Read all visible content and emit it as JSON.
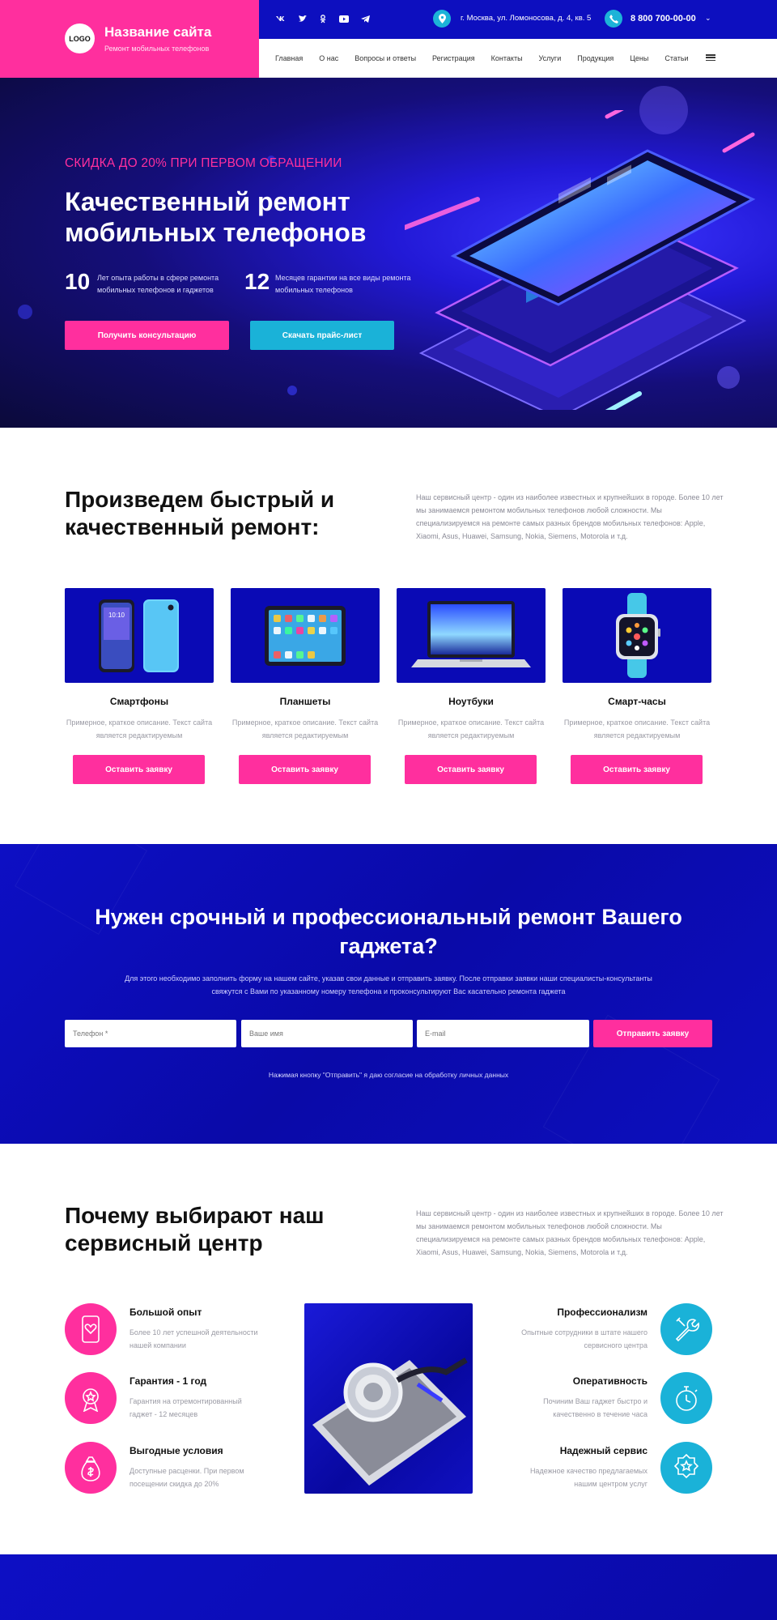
{
  "header": {
    "logo": "LOGO",
    "site_title": "Название сайта",
    "site_subtitle": "Ремонт мобильных телефонов",
    "socials": [
      "vk-icon",
      "twitter-icon",
      "odnoklassniki-icon",
      "youtube-icon",
      "telegram-icon"
    ],
    "address": "г. Москва, ул. Ломоносова, д. 4, кв. 5",
    "phone": "8 800 700-00-00",
    "nav": [
      "Главная",
      "О нас",
      "Вопросы и ответы",
      "Регистрация",
      "Контакты",
      "Услуги",
      "Продукция",
      "Цены",
      "Статьи"
    ]
  },
  "hero": {
    "promo": "СКИДКА ДО 20% ПРИ ПЕРВОМ ОБРАЩЕНИИ",
    "title": "Качественный ремонт мобильных телефонов",
    "stats": [
      {
        "num": "10",
        "text": "Лет опыта работы в сфере ремонта мобильных телефонов и гаджетов"
      },
      {
        "num": "12",
        "text": "Месяцев гарантии на все виды ремонта мобильных телефонов"
      }
    ],
    "btn_consult": "Получить консультацию",
    "btn_price": "Скачать прайс-лист"
  },
  "repair": {
    "title": "Произведем быстрый и качественный ремонт:",
    "desc": "Наш сервисный центр - один из наиболее известных и крупнейших в городе. Более 10 лет мы занимаемся ремонтом мобильных телефонов любой сложности. Мы специализируемся на ремонте самых разных брендов мобильных телефонов: Apple, Xiaomi, Asus, Huawei, Samsung, Nokia, Siemens, Motorola и т.д.",
    "cards": [
      {
        "name": "Смартфоны",
        "desc": "Примерное, краткое описание. Текст сайта является редактируемым",
        "btn": "Оставить заявку",
        "icon": "smartphone-icon"
      },
      {
        "name": "Планшеты",
        "desc": "Примерное, краткое описание. Текст сайта является редактируемым",
        "btn": "Оставить заявку",
        "icon": "tablet-icon"
      },
      {
        "name": "Ноутбуки",
        "desc": "Примерное, краткое описание. Текст сайта является редактируемым",
        "btn": "Оставить заявку",
        "icon": "laptop-icon"
      },
      {
        "name": "Смарт-часы",
        "desc": "Примерное, краткое описание. Текст сайта является редактируемым",
        "btn": "Оставить заявку",
        "icon": "smartwatch-icon"
      }
    ]
  },
  "form": {
    "title": "Нужен срочный и профессиональный ремонт Вашего гаджета?",
    "desc": "Для этого необходимо заполнить форму на нашем сайте, указав свои данные и отправить заявку. После отправки заявки наши специалисты-консультанты свяжутся с Вами по указанному номеру телефона и проконсультируют Вас касательно ремонта гаджета",
    "phone_placeholder": "Телефон *",
    "name_placeholder": "Ваше имя",
    "email_placeholder": "E-mail",
    "submit": "Отправить заявку",
    "consent": "Нажимая кнопку \"Отправить\" я даю согласие на обработку личных данных"
  },
  "why": {
    "title": "Почему выбирают наш сервисный центр",
    "desc": "Наш сервисный центр - один из наиболее известных и крупнейших в городе. Более 10 лет мы занимаемся ремонтом мобильных телефонов любой сложности. Мы специализируемся на ремонте самых разных брендов мобильных телефонов: Apple, Xiaomi, Asus, Huawei, Samsung, Nokia, Siemens, Motorola и т.д.",
    "left": [
      {
        "title": "Большой опыт",
        "text": "Более 10 лет успешной деятельности нашей компании",
        "icon": "phone-heart-icon"
      },
      {
        "title": "Гарантия - 1 год",
        "text": "Гарантия на отремонтированный гаджет - 12 месяцев",
        "icon": "medal-icon"
      },
      {
        "title": "Выгодные условия",
        "text": "Доступные расценки. При первом посещении скидка до 20%",
        "icon": "money-bag-icon"
      }
    ],
    "right": [
      {
        "title": "Профессионализм",
        "text": "Опытные сотрудники в штате нашего сервисного центра",
        "icon": "tools-icon"
      },
      {
        "title": "Оперативность",
        "text": "Починим Ваш гаджет быстро и качественно в течение часа",
        "icon": "stopwatch-icon"
      },
      {
        "title": "Надежный сервис",
        "text": "Надежное качество предлагаемых нашим центром услуг",
        "icon": "badge-star-icon"
      }
    ]
  },
  "colors": {
    "pink": "#ff2f9e",
    "cyan": "#1ab2d8",
    "blue": "#0d0fbf",
    "dark": "#0b0a3a"
  }
}
